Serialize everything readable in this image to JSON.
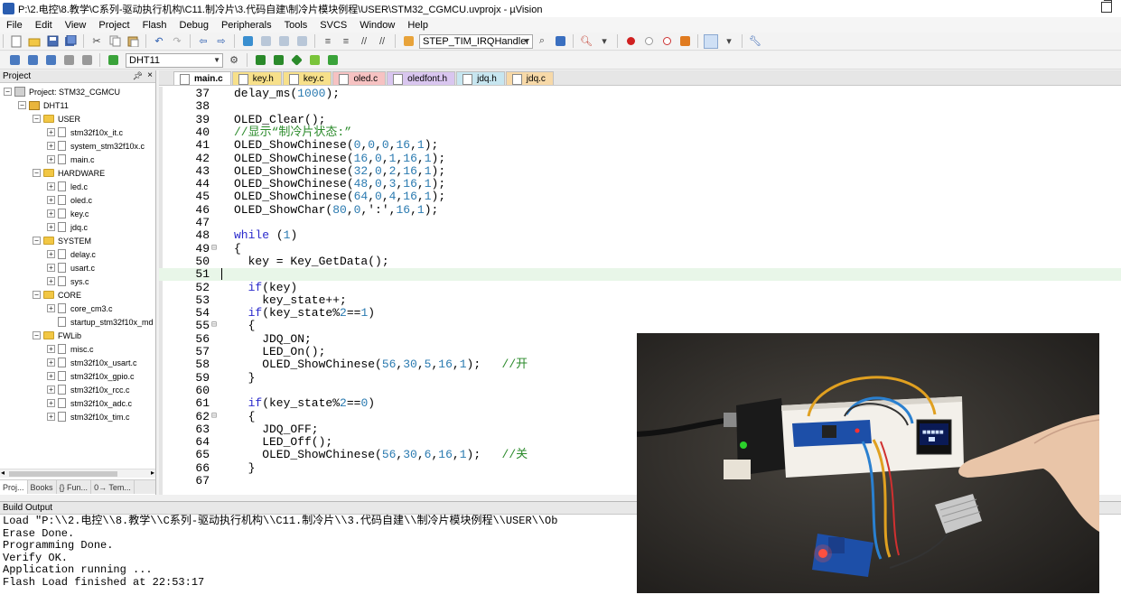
{
  "window": {
    "title": "P:\\2.电控\\8.教学\\C系列-驱动执行机构\\C11.制冷片\\3.代码自建\\制冷片模块例程\\USER\\STM32_CGMCU.uvprojx - µVision"
  },
  "menu": [
    "File",
    "Edit",
    "View",
    "Project",
    "Flash",
    "Debug",
    "Peripherals",
    "Tools",
    "SVCS",
    "Window",
    "Help"
  ],
  "toolbar": {
    "function_combo": "STEP_TIM_IRQHandler",
    "target_combo": "DHT11"
  },
  "project_pane": {
    "title": "Project",
    "tree": [
      {
        "label": "Project: STM32_CGMCU",
        "level": 0,
        "kind": "project",
        "exp": "−"
      },
      {
        "label": "DHT11",
        "level": 1,
        "kind": "target",
        "exp": "−"
      },
      {
        "label": "USER",
        "level": 2,
        "kind": "folder",
        "exp": "−"
      },
      {
        "label": "stm32f10x_it.c",
        "level": 3,
        "kind": "file",
        "exp": "+"
      },
      {
        "label": "system_stm32f10x.c",
        "level": 3,
        "kind": "file",
        "exp": "+"
      },
      {
        "label": "main.c",
        "level": 3,
        "kind": "file",
        "exp": "+"
      },
      {
        "label": "HARDWARE",
        "level": 2,
        "kind": "folder",
        "exp": "−"
      },
      {
        "label": "led.c",
        "level": 3,
        "kind": "file",
        "exp": "+"
      },
      {
        "label": "oled.c",
        "level": 3,
        "kind": "file",
        "exp": "+"
      },
      {
        "label": "key.c",
        "level": 3,
        "kind": "file",
        "exp": "+"
      },
      {
        "label": "jdq.c",
        "level": 3,
        "kind": "file",
        "exp": "+"
      },
      {
        "label": "SYSTEM",
        "level": 2,
        "kind": "folder",
        "exp": "−"
      },
      {
        "label": "delay.c",
        "level": 3,
        "kind": "file",
        "exp": "+"
      },
      {
        "label": "usart.c",
        "level": 3,
        "kind": "file",
        "exp": "+"
      },
      {
        "label": "sys.c",
        "level": 3,
        "kind": "file",
        "exp": "+"
      },
      {
        "label": "CORE",
        "level": 2,
        "kind": "folder",
        "exp": "−"
      },
      {
        "label": "core_cm3.c",
        "level": 3,
        "kind": "file",
        "exp": "+"
      },
      {
        "label": "startup_stm32f10x_md",
        "level": 3,
        "kind": "file",
        "exp": ""
      },
      {
        "label": "FWLib",
        "level": 2,
        "kind": "folder",
        "exp": "−"
      },
      {
        "label": "misc.c",
        "level": 3,
        "kind": "file",
        "exp": "+"
      },
      {
        "label": "stm32f10x_usart.c",
        "level": 3,
        "kind": "file",
        "exp": "+"
      },
      {
        "label": "stm32f10x_gpio.c",
        "level": 3,
        "kind": "file",
        "exp": "+"
      },
      {
        "label": "stm32f10x_rcc.c",
        "level": 3,
        "kind": "file",
        "exp": "+"
      },
      {
        "label": "stm32f10x_adc.c",
        "level": 3,
        "kind": "file",
        "exp": "+"
      },
      {
        "label": "stm32f10x_tim.c",
        "level": 3,
        "kind": "file",
        "exp": "+"
      }
    ],
    "tabs": [
      "Proj...",
      "Books",
      "{} Fun...",
      "0→ Tem..."
    ]
  },
  "editor": {
    "tabs": [
      {
        "label": "main.c",
        "active": true,
        "color": "#ffffff"
      },
      {
        "label": "key.h",
        "active": false,
        "color": "#f7e08a"
      },
      {
        "label": "key.c",
        "active": false,
        "color": "#f7e08a"
      },
      {
        "label": "oled.c",
        "active": false,
        "color": "#f6c2c2"
      },
      {
        "label": "oledfont.h",
        "active": false,
        "color": "#d9c6ef"
      },
      {
        "label": "jdq.h",
        "active": false,
        "color": "#c7e6f0"
      },
      {
        "label": "jdq.c",
        "active": false,
        "color": "#f7d9a8"
      }
    ],
    "lines": [
      {
        "num": "37",
        "fold": "",
        "code": "delay_ms(1000);",
        "indent": 0
      },
      {
        "num": "38",
        "fold": "",
        "code": "",
        "indent": 0
      },
      {
        "num": "39",
        "fold": "",
        "code": "OLED_Clear();",
        "indent": 0
      },
      {
        "num": "40",
        "fold": "",
        "code": "//显示“制冷片状态:”",
        "indent": 0,
        "comment": true
      },
      {
        "num": "41",
        "fold": "",
        "code": "OLED_ShowChinese(0,0,0,16,1);",
        "indent": 0
      },
      {
        "num": "42",
        "fold": "",
        "code": "OLED_ShowChinese(16,0,1,16,1);",
        "indent": 0
      },
      {
        "num": "43",
        "fold": "",
        "code": "OLED_ShowChinese(32,0,2,16,1);",
        "indent": 0
      },
      {
        "num": "44",
        "fold": "",
        "code": "OLED_ShowChinese(48,0,3,16,1);",
        "indent": 0
      },
      {
        "num": "45",
        "fold": "",
        "code": "OLED_ShowChinese(64,0,4,16,1);",
        "indent": 0
      },
      {
        "num": "46",
        "fold": "",
        "code": "OLED_ShowChar(80,0,':',16,1);",
        "indent": 0
      },
      {
        "num": "47",
        "fold": "",
        "code": "",
        "indent": 0
      },
      {
        "num": "48",
        "fold": "",
        "code": "while (1)",
        "indent": 0,
        "keyword": true
      },
      {
        "num": "49",
        "fold": "⊟",
        "code": "{",
        "indent": 0
      },
      {
        "num": "50",
        "fold": "",
        "code": "key = Key_GetData();",
        "indent": 1
      },
      {
        "num": "51",
        "fold": "",
        "code": "",
        "indent": 0,
        "current": true
      },
      {
        "num": "52",
        "fold": "",
        "code": "if(key)",
        "indent": 1,
        "keyword": true
      },
      {
        "num": "53",
        "fold": "",
        "code": "key_state++;",
        "indent": 2
      },
      {
        "num": "54",
        "fold": "",
        "code": "if(key_state%2==1)",
        "indent": 1,
        "keyword": true
      },
      {
        "num": "55",
        "fold": "⊟",
        "code": "{",
        "indent": 1
      },
      {
        "num": "56",
        "fold": "",
        "code": "JDQ_ON;",
        "indent": 2
      },
      {
        "num": "57",
        "fold": "",
        "code": "LED_On();",
        "indent": 2
      },
      {
        "num": "58",
        "fold": "",
        "code": "OLED_ShowChinese(56,30,5,16,1);   //开",
        "indent": 2
      },
      {
        "num": "59",
        "fold": "",
        "code": "}",
        "indent": 1
      },
      {
        "num": "60",
        "fold": "",
        "code": "",
        "indent": 0
      },
      {
        "num": "61",
        "fold": "",
        "code": "if(key_state%2==0)",
        "indent": 1,
        "keyword": true
      },
      {
        "num": "62",
        "fold": "⊟",
        "code": "{",
        "indent": 1
      },
      {
        "num": "63",
        "fold": "",
        "code": "JDQ_OFF;",
        "indent": 2
      },
      {
        "num": "64",
        "fold": "",
        "code": "LED_Off();",
        "indent": 2
      },
      {
        "num": "65",
        "fold": "",
        "code": "OLED_ShowChinese(56,30,6,16,1);   //关",
        "indent": 2
      },
      {
        "num": "66",
        "fold": "",
        "code": "}",
        "indent": 1
      },
      {
        "num": "67",
        "fold": "",
        "code": "",
        "indent": 0
      }
    ]
  },
  "build_output": {
    "title": "Build Output",
    "lines": [
      "Load \"P:\\\\2.电控\\\\8.教学\\\\C系列-驱动执行机构\\\\C11.制冷片\\\\3.代码自建\\\\制冷片模块例程\\\\USER\\\\Ob",
      "Erase Done.",
      "Programming Done.",
      "Verify OK.",
      "Application running ...",
      "Flash Load finished at 22:53:17"
    ]
  },
  "colors": {
    "current_line": "#e8f6e8",
    "keyword": "#2a2acc",
    "comment": "#2a8a2a",
    "number": "#2a7ab0"
  },
  "icons": [
    "new-file-icon",
    "open-icon",
    "save-icon",
    "save-all-icon",
    "cut-icon",
    "copy-icon",
    "paste-icon",
    "undo-icon",
    "redo-icon",
    "nav-back-icon",
    "nav-forward-icon",
    "bookmark-icon",
    "indent-icon",
    "unindent-icon",
    "comment-icon",
    "uncomment-icon",
    "find-icon",
    "debug-icon",
    "breakpoint-icon",
    "build-icon",
    "rebuild-icon",
    "download-icon",
    "options-icon",
    "manage-icon"
  ]
}
